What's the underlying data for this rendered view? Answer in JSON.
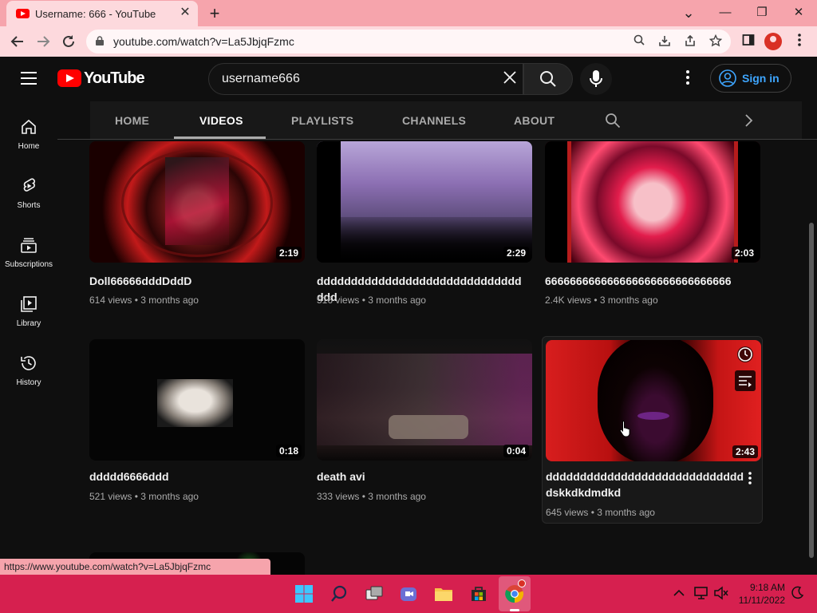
{
  "browser": {
    "tab_title": "Username: 666 - YouTube",
    "tab_close": "✕",
    "new_tab": "+",
    "address": "youtube.com/watch?v=La5JbjqFzmc",
    "status_url": "https://www.youtube.com/watch?v=La5JbjqFzmc",
    "window_minimize": "—",
    "window_restore": "❐",
    "window_close": "✕",
    "dropdown": "⌄"
  },
  "youtube": {
    "logo_text": "YouTube",
    "search_query": "username666",
    "sign_in": "Sign in",
    "guide": [
      {
        "label": "Home",
        "icon": "home-icon"
      },
      {
        "label": "Shorts",
        "icon": "shorts-icon"
      },
      {
        "label": "Subscriptions",
        "icon": "subscriptions-icon"
      },
      {
        "label": "Library",
        "icon": "library-icon"
      },
      {
        "label": "History",
        "icon": "history-icon"
      }
    ],
    "channel_tabs": [
      "HOME",
      "VIDEOS",
      "PLAYLISTS",
      "CHANNELS",
      "ABOUT"
    ],
    "active_tab": "VIDEOS",
    "videos": [
      {
        "title": "Doll66666dddDddD",
        "views": "614 views",
        "age": "3 months ago",
        "duration": "2:19"
      },
      {
        "title": "ddddddddddddddddddddddddddddddddd",
        "views": "516 views",
        "age": "3 months ago",
        "duration": "2:29"
      },
      {
        "title": "666666666666666666666666666666",
        "views": "2.4K views",
        "age": "3 months ago",
        "duration": "2:03"
      },
      {
        "title": "ddddd6666ddd",
        "views": "521 views",
        "age": "3 months ago",
        "duration": "0:18"
      },
      {
        "title": "death avi",
        "views": "333 views",
        "age": "3 months ago",
        "duration": "0:04"
      },
      {
        "title": "ddddddddddddddddddddddddddddddskkdkdmdkd",
        "views": "645 views",
        "age": "3 months ago",
        "duration": "2:43"
      }
    ],
    "meta_separator": "•"
  },
  "taskbar": {
    "time": "9:18 AM",
    "date": "11/11/2022"
  },
  "colors": {
    "chrome_titlebar": "#f6a4ac",
    "chrome_toolbar": "#fdd9dd",
    "youtube_bg": "#0f0f0f",
    "youtube_red": "#ff0000",
    "sign_in_blue": "#3ea6ff",
    "taskbar": "#d6204f"
  }
}
